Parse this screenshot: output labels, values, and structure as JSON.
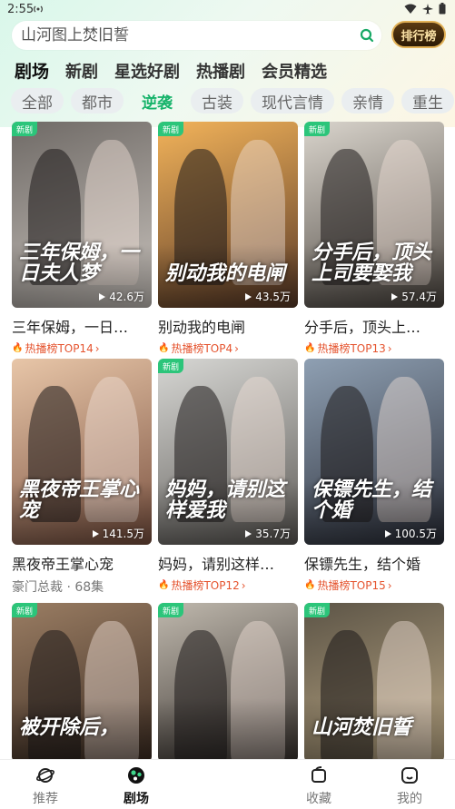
{
  "status": {
    "time": "2:55"
  },
  "search": {
    "placeholder": "山河图上焚旧誓"
  },
  "rank_button": {
    "label": "排行榜"
  },
  "main_tabs": [
    "剧场",
    "新剧",
    "星选好剧",
    "热播剧",
    "会员精选"
  ],
  "genres": [
    "全部",
    "都市",
    "逆袭",
    "古装",
    "现代言情",
    "亲情",
    "重生"
  ],
  "cards": [
    {
      "title": "三年保姆，一日…",
      "poster_text": "三年保姆，一日夫人梦",
      "badge": "新剧",
      "views": "42.6万",
      "subtitle": "热播榜TOP14",
      "hot": true,
      "bg1": "#6f6a66",
      "bg2": "#c9c3bd"
    },
    {
      "title": "别动我的电闸",
      "poster_text": "别动我的电闸",
      "badge": "新剧",
      "views": "43.5万",
      "subtitle": "热播榜TOP4",
      "hot": true,
      "bg1": "#f2b35a",
      "bg2": "#5a3a28"
    },
    {
      "title": "分手后，顶头上…",
      "poster_text": "分手后，顶头上司要娶我",
      "badge": "新剧",
      "views": "57.4万",
      "subtitle": "热播榜TOP13",
      "hot": true,
      "bg1": "#d9d4cc",
      "bg2": "#4c4640"
    },
    {
      "title": "黑夜帝王掌心宠",
      "poster_text": "黑夜帝王掌心宠",
      "badge": "",
      "views": "141.5万",
      "subtitle": "豪门总裁 · 68集",
      "hot": false,
      "bg1": "#e8c6a8",
      "bg2": "#7a5140"
    },
    {
      "title": "妈妈，请别这样…",
      "poster_text": "妈妈，请别这样爱我",
      "badge": "新剧",
      "views": "35.7万",
      "subtitle": "热播榜TOP12",
      "hot": true,
      "bg1": "#d7d7d4",
      "bg2": "#5e5b57"
    },
    {
      "title": "保镖先生，结个婚",
      "poster_text": "保镖先生，结个婚",
      "badge": "",
      "views": "100.5万",
      "subtitle": "热播榜TOP15",
      "hot": true,
      "bg1": "#8fa0b3",
      "bg2": "#2b2e38"
    },
    {
      "title": "",
      "poster_text": "被开除后，",
      "badge": "新剧",
      "views": "",
      "subtitle": "",
      "hot": false,
      "bg1": "#9a7d63",
      "bg2": "#3c2c22"
    },
    {
      "title": "",
      "poster_text": "",
      "badge": "新剧",
      "views": "",
      "subtitle": "",
      "hot": false,
      "bg1": "#bfb8ad",
      "bg2": "#3a3430"
    },
    {
      "title": "",
      "poster_text": "山河焚旧誓",
      "badge": "新剧",
      "views": "",
      "subtitle": "",
      "hot": false,
      "bg1": "#5d5547",
      "bg2": "#b9a683"
    }
  ],
  "bottom_nav": [
    {
      "label": "推荐",
      "icon": "planet-icon"
    },
    {
      "label": "剧场",
      "icon": "theater-icon"
    },
    {
      "label": "收藏",
      "icon": "collection-icon"
    },
    {
      "label": "我的",
      "icon": "profile-icon"
    }
  ],
  "colors": {
    "accent": "#16b36a",
    "hot": "#e5542f",
    "badge": "#2cc57a"
  }
}
